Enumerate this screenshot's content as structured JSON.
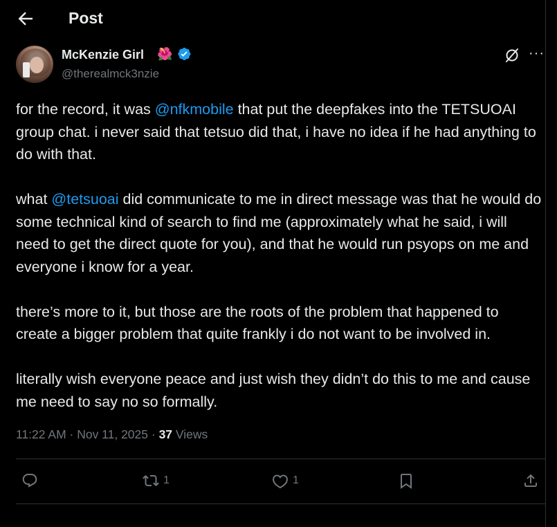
{
  "header": {
    "title": "Post"
  },
  "author": {
    "name": "McKenzie Girl",
    "emoji": "🌺",
    "handle": "@therealmck3nzie",
    "verified": true
  },
  "tweet": {
    "p1_a": "for the record, it was ",
    "p1_mention": "@nfkmobile",
    "p1_b": " that put the deepfakes into the TETSUOAI group chat. i never said that tetsuo did that, i have no idea if he had anything to do with that.",
    "p2_a": "what ",
    "p2_mention": "@tetsuoai",
    "p2_b": " did communicate to me in direct message was that he would do some technical kind of search to find me (approximately what he said, i will need to get the direct quote for you), and that he would run psyops on me and everyone i know for a year.",
    "p3": "there’s more to it, but those are the roots of the problem that happened to create a bigger problem that quite frankly i do not want to be involved in.",
    "p4": "literally wish everyone peace and just wish they didn’t do this to me and cause me need to say no so formally."
  },
  "meta": {
    "time": "11:22 AM",
    "sep1": " · ",
    "date": "Nov 11, 2025",
    "sep2": " · ",
    "views_count": "37",
    "views_label": " Views"
  },
  "actions": {
    "reply_icon": "reply-icon",
    "repost_icon": "repost-icon",
    "repost_count": "1",
    "like_icon": "heart-icon",
    "like_count": "1",
    "bookmark_icon": "bookmark-icon",
    "share_icon": "share-icon"
  },
  "colors": {
    "accent": "#1d9bf0",
    "muted": "#71767b",
    "text": "#e7e9ea",
    "background": "#000000"
  }
}
